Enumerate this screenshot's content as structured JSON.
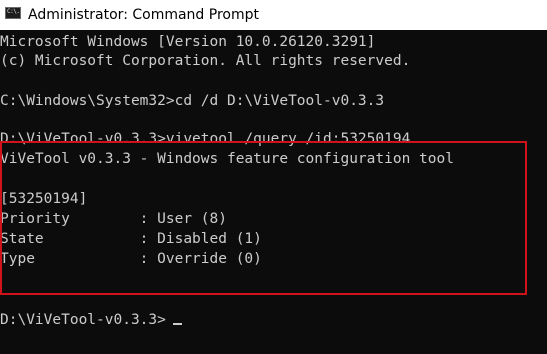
{
  "window": {
    "title": "Administrator: Command Prompt",
    "icon": "command-prompt-icon",
    "icon_text": "C:\\."
  },
  "console": {
    "lines": [
      "Microsoft Windows [Version 10.0.26120.3291]",
      "(c) Microsoft Corporation. All rights reserved.",
      "",
      "C:\\Windows\\System32>cd /d D:\\ViVeTool-v0.3.3",
      "",
      "D:\\ViVeTool-v0.3.3>vivetool /query /id:53250194",
      "ViVeTool v0.3.3 - Windows feature configuration tool",
      "",
      "[53250194]",
      "Priority        : User (8)",
      "State           : Disabled (1)",
      "Type            : Override (0)",
      "",
      "",
      "D:\\ViVeTool-v0.3.3>"
    ]
  },
  "colors": {
    "background": "#0c0c0c",
    "text": "#cccccc",
    "highlight_border": "#d0121b",
    "titlebar": "#ffffff"
  }
}
